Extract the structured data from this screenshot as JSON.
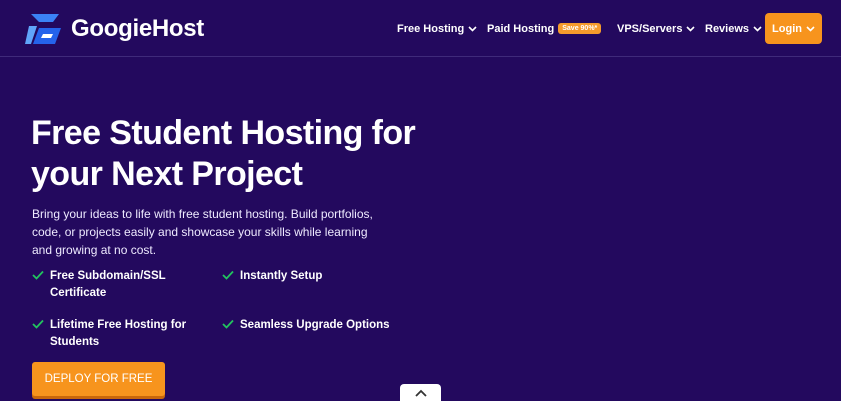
{
  "brand": {
    "name": "GoogieHost"
  },
  "nav": {
    "free_hosting": "Free Hosting",
    "paid_hosting": "Paid Hosting",
    "paid_badge": "Save 90%*",
    "vps": "VPS/Servers",
    "reviews": "Reviews",
    "login": "Login"
  },
  "hero": {
    "title_line1": "Free Student Hosting for",
    "title_line2": "your Next Project",
    "description": "Bring your ideas to life with free student hosting. Build portfolios, code, or projects easily and showcase your skills while learning and growing at no cost.",
    "features": [
      {
        "line1": "Free Subdomain/SSL",
        "line2": "Certificate"
      },
      {
        "line1": "Instantly Setup",
        "line2": ""
      },
      {
        "line1": "Lifetime Free Hosting for",
        "line2": "Students"
      },
      {
        "line1": "Seamless Upgrade Options",
        "line2": ""
      }
    ],
    "cta": "DEPLOY FOR FREE"
  },
  "colors": {
    "background": "#23095e",
    "accent": "#f7941d",
    "check": "#22c55e"
  }
}
